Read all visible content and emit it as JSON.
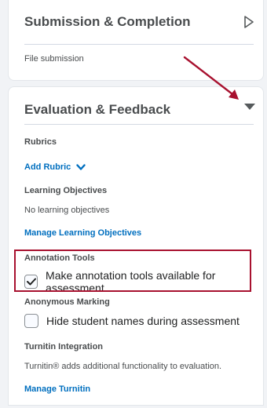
{
  "submission": {
    "title": "Submission & Completion",
    "summary": "File submission"
  },
  "evaluation": {
    "title": "Evaluation & Feedback",
    "rubrics_label": "Rubrics",
    "add_rubric": "Add Rubric",
    "objectives_label": "Learning Objectives",
    "objectives_value": "No learning objectives",
    "manage_objectives": "Manage Learning Objectives",
    "annotation_label": "Annotation Tools",
    "annotation_checkbox": "Make annotation tools available for assessment",
    "annotation_checked": true,
    "anonymous_label": "Anonymous Marking",
    "anonymous_checkbox": "Hide student names during assessment",
    "anonymous_checked": false,
    "turnitin_label": "Turnitin Integration",
    "turnitin_desc": "Turnitin® adds additional functionality to evaluation.",
    "manage_turnitin": "Manage Turnitin"
  },
  "colors": {
    "link": "#006fbf",
    "highlight": "#a8112f",
    "arrow": "#a8112f"
  },
  "icons": {
    "expand": "chevron-right-icon",
    "collapse": "caret-down-icon",
    "dropdown": "chevron-down-icon",
    "check": "checkmark-icon"
  }
}
